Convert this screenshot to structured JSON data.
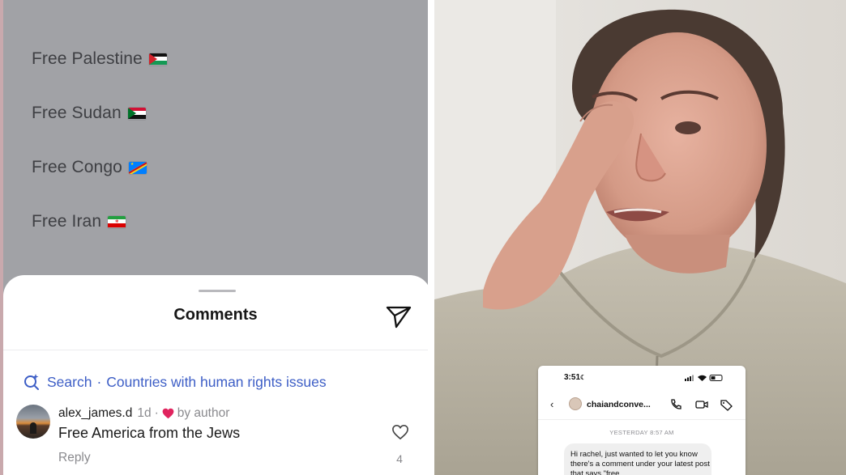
{
  "post": {
    "lines": [
      {
        "text": "Free Palestine",
        "flag": "palestine-flag"
      },
      {
        "text": "Free Sudan",
        "flag": "sudan-flag"
      },
      {
        "text": "Free Congo",
        "flag": "congo-flag"
      },
      {
        "text": "Free Iran",
        "flag": "iran-flag"
      }
    ]
  },
  "comments_sheet": {
    "title": "Comments",
    "search_label": "Search",
    "search_separator": "·",
    "search_query": "Countries with human rights issues",
    "comment": {
      "username": "alex_james.d",
      "time": "1d",
      "separator": "·",
      "liked_by": "by author",
      "text": "Free America from the Jews",
      "reply_label": "Reply",
      "like_count": "4"
    }
  },
  "dm_overlay": {
    "status_time": "3:51",
    "contact_name": "chaiandconve...",
    "date_label": "YESTERDAY 8:57 AM",
    "message": "Hi rachel, just wanted to let you know there's a comment under your latest post that says \"free"
  },
  "colors": {
    "post_background": "#a1a2a6",
    "post_text": "#3e3f43",
    "search_link": "#3d5ec6",
    "heart_red": "#e0245e"
  }
}
